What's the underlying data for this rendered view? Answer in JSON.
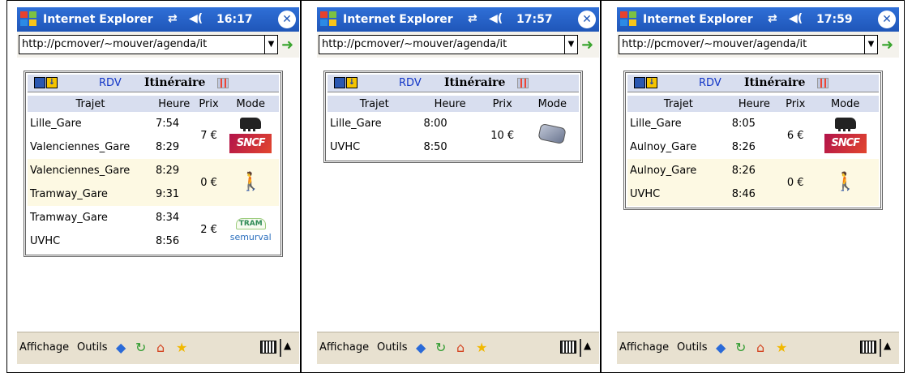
{
  "colors": {
    "titlebar": "#1f56b8",
    "card_header": "#d8deef",
    "link": "#1236c8",
    "toolbar": "#e8e1d0"
  },
  "screens": [
    {
      "app_title": "Internet Explorer",
      "clock": "16:17",
      "address": "http://pcmover/~mouver/agenda/it",
      "tabs": {
        "rdv": "RDV",
        "itineraire": "Itinéraire"
      },
      "headers": [
        "Trajet",
        "Heure",
        "Prix",
        "Mode"
      ],
      "legs": [
        {
          "rows": [
            {
              "trajet": "Lille_Gare",
              "heure": "7:54"
            },
            {
              "trajet": "Valenciennes_Gare",
              "heure": "8:29"
            }
          ],
          "prix": "7 €",
          "mode": [
            "train-icon",
            "sncf-icon"
          ],
          "mode_text": [
            "",
            "SNCF"
          ]
        },
        {
          "rows": [
            {
              "trajet": "Valenciennes_Gare",
              "heure": "8:29"
            },
            {
              "trajet": "Tramway_Gare",
              "heure": "9:31"
            }
          ],
          "prix": "0 €",
          "mode": [
            "walk-icon"
          ],
          "mode_text": [
            "🚶"
          ]
        },
        {
          "rows": [
            {
              "trajet": "Tramway_Gare",
              "heure": "8:34"
            },
            {
              "trajet": "UVHC",
              "heure": "8:56"
            }
          ],
          "prix": "2 €",
          "mode": [
            "tram-icon",
            "semurval-icon"
          ],
          "mode_text": [
            "TRAM",
            "semurval"
          ]
        }
      ],
      "toolbar": {
        "affichage": "Affichage",
        "outils": "Outils"
      }
    },
    {
      "app_title": "Internet Explorer",
      "clock": "17:57",
      "address": "http://pcmover/~mouver/agenda/it",
      "tabs": {
        "rdv": "RDV",
        "itineraire": "Itinéraire"
      },
      "headers": [
        "Trajet",
        "Heure",
        "Prix",
        "Mode"
      ],
      "legs": [
        {
          "rows": [
            {
              "trajet": "Lille_Gare",
              "heure": "8:00"
            },
            {
              "trajet": "UVHC",
              "heure": "8:50"
            }
          ],
          "prix": "10 €",
          "mode": [
            "bus-icon"
          ],
          "mode_text": [
            ""
          ]
        }
      ],
      "toolbar": {
        "affichage": "Affichage",
        "outils": "Outils"
      }
    },
    {
      "app_title": "Internet Explorer",
      "clock": "17:59",
      "address": "http://pcmover/~mouver/agenda/it",
      "tabs": {
        "rdv": "RDV",
        "itineraire": "Itinéraire"
      },
      "headers": [
        "Trajet",
        "Heure",
        "Prix",
        "Mode"
      ],
      "legs": [
        {
          "rows": [
            {
              "trajet": "Lille_Gare",
              "heure": "8:05"
            },
            {
              "trajet": "Aulnoy_Gare",
              "heure": "8:26"
            }
          ],
          "prix": "6 €",
          "mode": [
            "train-icon",
            "sncf-icon"
          ],
          "mode_text": [
            "",
            "SNCF"
          ]
        },
        {
          "rows": [
            {
              "trajet": "Aulnoy_Gare",
              "heure": "8:26"
            },
            {
              "trajet": "UVHC",
              "heure": "8:46"
            }
          ],
          "prix": "0 €",
          "mode": [
            "walk-icon"
          ],
          "mode_text": [
            "🚶"
          ]
        }
      ],
      "toolbar": {
        "affichage": "Affichage",
        "outils": "Outils"
      }
    }
  ]
}
